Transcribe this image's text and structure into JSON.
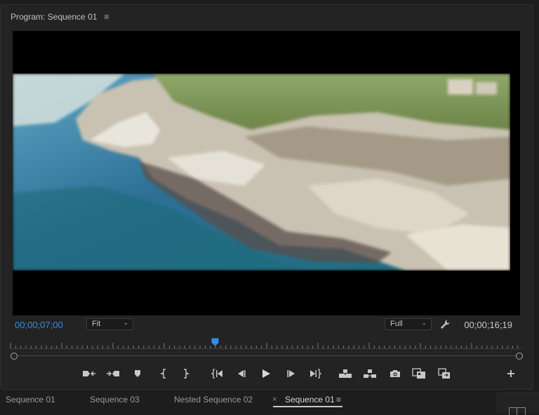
{
  "panel": {
    "title": "Program: Sequence 01",
    "menu_icon": "hamburger-menu-icon"
  },
  "viewer": {
    "scene": "blurred aerial view of rocky coastline and turquoise sea"
  },
  "timecode": {
    "current": "00;00;07;00",
    "duration": "00;00;16;19",
    "current_color": "#2e8ded"
  },
  "zoom": {
    "value": "Fit"
  },
  "resolution": {
    "value": "Full"
  },
  "playhead": {
    "position_fraction": 0.42
  },
  "transport_buttons": [
    "mark-in-icon",
    "mark-out-icon",
    "add-marker-icon",
    "in-bracket-icon",
    "out-bracket-icon",
    "go-to-in-icon",
    "step-back-icon",
    "play-icon",
    "step-forward-icon",
    "go-to-out-icon",
    "lift-icon",
    "extract-icon",
    "export-frame-icon",
    "comparison-view-icon",
    "proxy-toggle-icon",
    "add-button-icon"
  ],
  "tabs": {
    "items": [
      {
        "label": "Sequence 01"
      },
      {
        "label": "Sequence 03"
      },
      {
        "label": "Nested Sequence 02"
      },
      {
        "label": "Sequence 01"
      }
    ],
    "close_symbol": "×",
    "menu_symbol": "≡"
  },
  "colors": {
    "accent": "#2e8ded",
    "background": "#232323"
  }
}
